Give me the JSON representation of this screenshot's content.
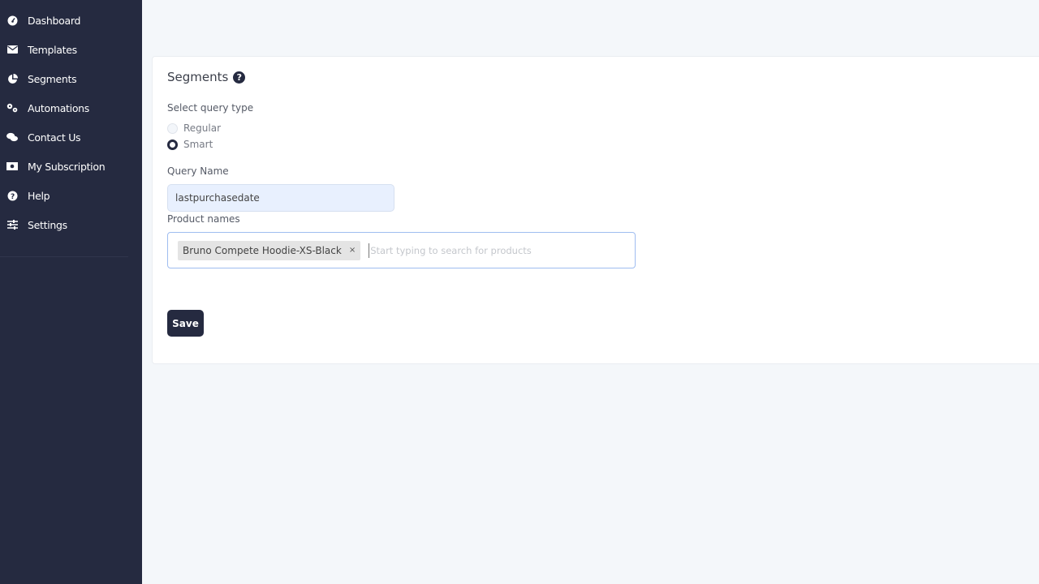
{
  "sidebar": {
    "items": [
      {
        "label": "Dashboard",
        "icon": "tachometer-icon"
      },
      {
        "label": "Templates",
        "icon": "envelope-icon"
      },
      {
        "label": "Segments",
        "icon": "pie-chart-icon"
      },
      {
        "label": "Automations",
        "icon": "cogs-icon"
      },
      {
        "label": "Contact Us",
        "icon": "comments-icon"
      },
      {
        "label": "My Subscription",
        "icon": "money-bill-icon"
      },
      {
        "label": "Help",
        "icon": "question-circle-icon"
      },
      {
        "label": "Settings",
        "icon": "sliders-icon"
      }
    ]
  },
  "main": {
    "title": "Segments",
    "query_type_label": "Select query type",
    "options": [
      {
        "label": "Regular",
        "selected": false
      },
      {
        "label": "Smart",
        "selected": true
      }
    ],
    "query_name_label": "Query Name",
    "query_name_value": "lastpurchasedate",
    "product_names_label": "Product names",
    "product_tags": [
      "Bruno Compete Hoodie-XS-Black"
    ],
    "product_placeholder": "Start typing to search for products",
    "save_label": "Save"
  },
  "colors": {
    "sidebar": "#252a40",
    "accent": "#252a40",
    "input_bg": "#e8f0fe"
  }
}
